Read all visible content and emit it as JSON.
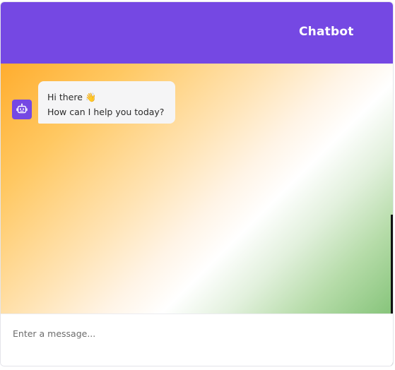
{
  "header": {
    "title": "Chatbot"
  },
  "colors": {
    "header_background": "#7548e3",
    "avatar_background": "#7548e3",
    "bubble_background": "#f5f5f6"
  },
  "messages": [
    {
      "sender": "bot",
      "avatar_icon": "robot-icon",
      "lines": [
        "Hi there 👋",
        "How can I help you today?"
      ]
    }
  ],
  "input": {
    "placeholder": "Enter a message..."
  }
}
